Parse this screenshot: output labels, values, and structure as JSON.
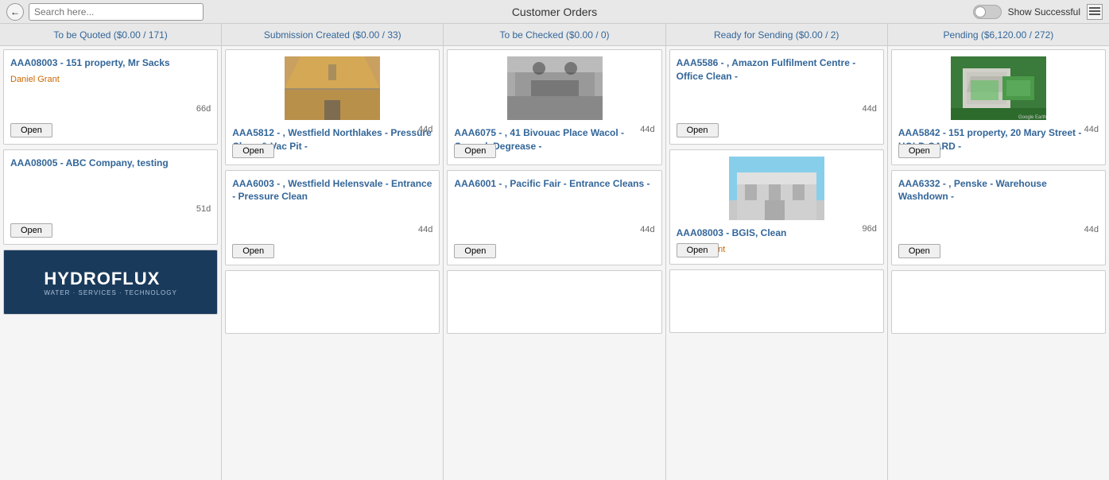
{
  "header": {
    "title": "Customer Orders",
    "search_placeholder": "Search here...",
    "toggle_label": "Show Successful",
    "back_icon": "←",
    "list_icon": "☰"
  },
  "columns": [
    {
      "id": "to-be-quoted",
      "label": "To be Quoted ($0.00 / 171)",
      "cards": [
        {
          "id": "card-aaa08003-1",
          "title": "AAA08003 - 151 property, Mr Sacks",
          "contact": "Daniel Grant",
          "days": "66d",
          "has_image": false,
          "open_label": "Open"
        },
        {
          "id": "card-aaa08005",
          "title": "AAA08005 - ABC Company, testing",
          "contact": "",
          "days": "51d",
          "has_image": false,
          "open_label": "Open"
        },
        {
          "id": "card-logo",
          "is_logo": true
        }
      ]
    },
    {
      "id": "submission-created",
      "label": "Submission Created ($0.00 / 33)",
      "cards": [
        {
          "id": "card-aaa5812",
          "title": "AAA5812 - , Westfield Northlakes - Pressure Clean & Vac Pit -",
          "contact": "",
          "days": "44d",
          "has_image": true,
          "img_type": "parking",
          "open_label": "Open"
        },
        {
          "id": "card-aaa6003",
          "title": "AAA6003 - , Westfield Helensvale - Entrance - Pressure Clean",
          "contact": "",
          "days": "44d",
          "has_image": false,
          "open_label": "Open"
        },
        {
          "id": "card-sub-3",
          "title": "",
          "is_placeholder": true
        }
      ]
    },
    {
      "id": "to-be-checked",
      "label": "To be Checked ($0.00 / 0)",
      "cards": [
        {
          "id": "card-aaa6075",
          "title": "AAA6075 - , 41 Bivouac Place Wacol - Carpark Degrease -",
          "contact": "",
          "days": "44d",
          "has_image": true,
          "img_type": "carpark",
          "open_label": "Open"
        },
        {
          "id": "card-aaa6001",
          "title": "AAA6001 - , Pacific Fair - Entrance Cleans -",
          "contact": "",
          "days": "44d",
          "has_image": false,
          "open_label": "Open"
        },
        {
          "id": "card-check-3",
          "title": "",
          "is_placeholder": true
        }
      ]
    },
    {
      "id": "ready-for-sending",
      "label": "Ready for Sending ($0.00 / 2)",
      "cards": [
        {
          "id": "card-aaa5586",
          "title": "AAA5586 - , Amazon Fulfilment Centre - Office Clean -",
          "contact": "",
          "days": "44d",
          "has_image": false,
          "open_label": "Open"
        },
        {
          "id": "card-aaa08003-2",
          "title": "AAA08003 - BGIS, Clean",
          "contact": "Daniel Grant",
          "days": "96d",
          "has_image": true,
          "img_type": "building",
          "open_label": "Open"
        },
        {
          "id": "card-ready-3",
          "title": "",
          "is_placeholder": true
        }
      ]
    },
    {
      "id": "pending",
      "label": "Pending ($6,120.00 / 272)",
      "cards": [
        {
          "id": "card-aaa5842",
          "title": "AAA5842 - 151 property, 20 Mary Street - HOLD CARD -",
          "contact": "",
          "days": "44d",
          "has_image": true,
          "img_type": "aerial",
          "open_label": "Open"
        },
        {
          "id": "card-aaa6332",
          "title": "AAA6332 - , Penske - Warehouse Washdown -",
          "contact": "",
          "days": "44d",
          "has_image": false,
          "open_label": "Open"
        },
        {
          "id": "card-pending-3",
          "title": "",
          "is_placeholder": true
        }
      ]
    }
  ],
  "logo": {
    "name": "HYDROFLUX",
    "tagline": "WATER · SERVICES · TECHNOLOGY"
  }
}
